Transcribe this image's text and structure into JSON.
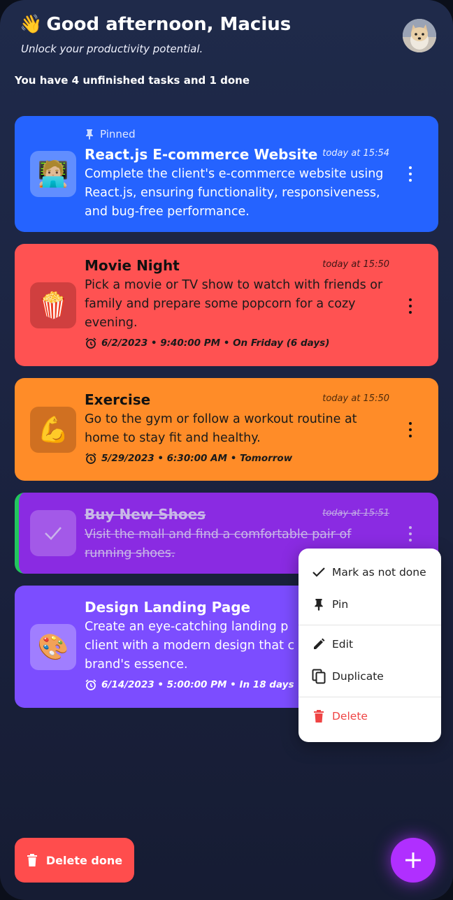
{
  "header": {
    "wave_emoji": "👋",
    "greeting": "Good afternoon, Macius",
    "subtitle": "Unlock your productivity potential.",
    "summary": "You have 4 unfinished tasks and 1 done"
  },
  "pinned_label": "Pinned",
  "tasks": [
    {
      "emoji": "🧑🏼‍💻",
      "title": "React.js E-commerce Website",
      "time": "today at 15:54",
      "description": "Complete the client's e-commerce website using React.js, ensuring functionality, responsiveness, and bug-free performance.",
      "pinned": true,
      "done": false,
      "color": "#2563ff"
    },
    {
      "emoji": "🍿",
      "title": "Movie Night",
      "time": "today at 15:50",
      "description": "Pick a movie or TV show to watch with friends or family and prepare some popcorn for a cozy evening.",
      "due": "6/2/2023 • 9:40:00 PM • On Friday (6 days)",
      "done": false,
      "color": "#ff5252"
    },
    {
      "emoji": "💪",
      "title": "Exercise",
      "time": "today at 15:50",
      "description": "Go to the gym or follow a workout routine at home to stay fit and healthy.",
      "due": "5/29/2023 • 6:30:00 AM • Tomorrow",
      "done": false,
      "color": "#ff8c28"
    },
    {
      "title": "Buy New Shoes",
      "time": "today at 15:51",
      "description": "Visit the mall and find a comfortable pair of running shoes.",
      "done": true,
      "color": "#8a2be2",
      "done_accent": "#22c55e"
    },
    {
      "emoji": "🎨",
      "title": "Design Landing Page",
      "description": "Create an eye-catching landing p",
      "description_line2": "client with a modern design that c",
      "description_line3": "brand's essence.",
      "due": "6/14/2023 • 5:00:00 PM • In 18 days",
      "done": false,
      "color": "#7c4dff"
    }
  ],
  "context_menu": {
    "items": [
      {
        "label": "Mark as not done",
        "icon": "check-icon"
      },
      {
        "label": "Pin",
        "icon": "pin-icon"
      },
      {
        "label": "Edit",
        "icon": "pencil-icon"
      },
      {
        "label": "Duplicate",
        "icon": "duplicate-icon"
      },
      {
        "label": "Delete",
        "icon": "trash-icon",
        "color": "#ef4444"
      }
    ]
  },
  "footer": {
    "delete_done_label": "Delete done",
    "add_icon": "plus-icon"
  }
}
